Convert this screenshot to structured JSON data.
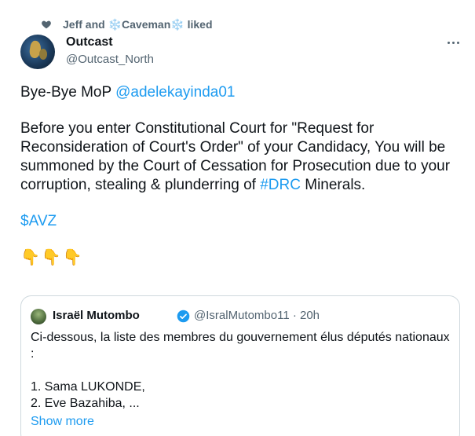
{
  "social_context": {
    "name1": "Jeff",
    "and": "and",
    "snow1": "❄️",
    "name2": "Caveman",
    "snow2": "❄️",
    "liked": "liked",
    "icon": "heart-icon"
  },
  "author": {
    "display_name": "Outcast",
    "handle": "@Outcast_North",
    "avatar_icon": "globe-avatar"
  },
  "tweet": {
    "line1_prefix": "Bye-Bye MoP ",
    "line1_mention": "@adelekayinda01",
    "para2_before": "Before you enter Constitutional Court for \"Request for Reconsideration of Court's Order\" of your Candidacy, You will be summoned by the Court of Cessation for Prosecution due to your corruption, stealing & plunderring of ",
    "para2_hashtag": "#DRC",
    "para2_after": " Minerals.",
    "cashtag": "$AVZ",
    "emojis": "👇👇👇"
  },
  "quote": {
    "name": "Israël Mutombo",
    "handle_time": "@IsralMutombo11 · 20h",
    "line1": "Ci-dessous, la liste des membres du gouvernement élus députés nationaux  :",
    "item1": "1. Sama LUKONDE,",
    "item2": "2. Eve Bazahiba, ...",
    "show_more": "Show more"
  },
  "colors": {
    "link": "#1d9bf0",
    "secondary": "#536471",
    "border": "#cfd9de",
    "text": "#0f1419"
  }
}
